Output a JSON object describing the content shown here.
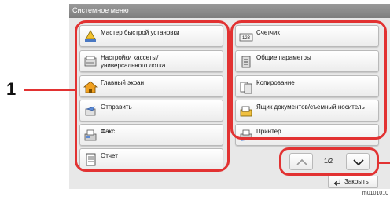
{
  "window": {
    "title": "Системное меню"
  },
  "left_menu": [
    {
      "label": "Мастер быстрой установки",
      "icon": "wizard-hat-icon"
    },
    {
      "label": "Настройки кассеты/\nуниверсального лотка",
      "icon": "cassette-icon"
    },
    {
      "label": "Главный экран",
      "icon": "home-icon"
    },
    {
      "label": "Отправить",
      "icon": "send-icon"
    },
    {
      "label": "Факс",
      "icon": "fax-icon"
    },
    {
      "label": "Отчет",
      "icon": "report-icon"
    }
  ],
  "right_menu": [
    {
      "label": "Счетчик",
      "icon": "counter-icon"
    },
    {
      "label": "Общие параметры",
      "icon": "common-settings-icon"
    },
    {
      "label": "Копирование",
      "icon": "copy-icon"
    },
    {
      "label": "Ящик документов/съемный носитель",
      "icon": "document-box-icon"
    },
    {
      "label": "Принтер",
      "icon": "printer-icon"
    }
  ],
  "pagination": {
    "indicator": "1/2"
  },
  "close_label": "Закрыть",
  "callout": {
    "number": "1"
  },
  "caption": "m0101010",
  "colors": {
    "highlight": "#e23232",
    "title_bar": "#888888",
    "panel": "#e8e8e8"
  }
}
